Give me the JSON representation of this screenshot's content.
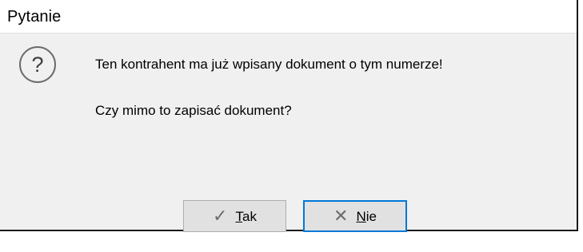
{
  "window": {
    "title": "Pytanie"
  },
  "message": {
    "line1": "Ten kontrahent ma już wpisany dokument o tym numerze!",
    "line2": "Czy mimo to zapisać dokument?"
  },
  "icons": {
    "dialog_icon": "question-mark-icon",
    "dialog_icon_glyph": "?",
    "yes_icon": "check-icon",
    "yes_icon_glyph": "✓",
    "no_icon": "x-icon",
    "no_icon_glyph": "✕"
  },
  "buttons": {
    "yes": {
      "mnemonic": "T",
      "rest": "ak"
    },
    "no": {
      "mnemonic": "N",
      "rest": "ie"
    }
  },
  "colors": {
    "focus_border": "#0078d7",
    "button_bg": "#e1e1e1",
    "dialog_bg": "#f0f0f0"
  }
}
